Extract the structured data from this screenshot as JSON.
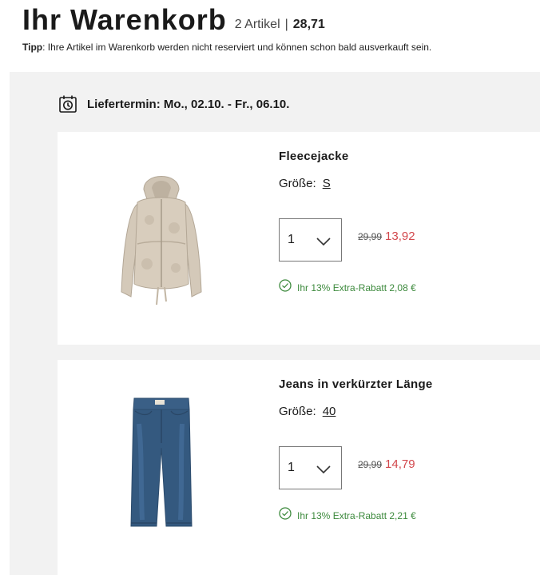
{
  "header": {
    "title": "Ihr Warenkorb",
    "count": "2 Artikel",
    "separator": "|",
    "total": "28,71"
  },
  "tip": {
    "label": "Tipp",
    "text": ": Ihre Artikel im Warenkorb werden nicht reserviert und können schon bald ausverkauft sein."
  },
  "delivery": {
    "icon": "calendar-clock-icon",
    "text": "Liefertermin: Mo., 02.10. - Fr., 06.10."
  },
  "items": [
    {
      "name": "Fleecejacke",
      "size_label": "Größe:",
      "size": "S",
      "quantity": "1",
      "old_price": "29,99",
      "new_price": "13,92",
      "discount_text": "Ihr 13% Extra-Rabatt 2,08 €",
      "image_icon": "fleece-jacket-image"
    },
    {
      "name": "Jeans in verkürzter Länge",
      "size_label": "Größe:",
      "size": "40",
      "quantity": "1",
      "old_price": "29,99",
      "new_price": "14,79",
      "discount_text": "Ihr 13% Extra-Rabatt 2,21 €",
      "image_icon": "jeans-image"
    }
  ],
  "colors": {
    "sale_red": "#d2484d",
    "discount_green": "#3d8a3d",
    "cart_background": "#f2f2f2"
  }
}
